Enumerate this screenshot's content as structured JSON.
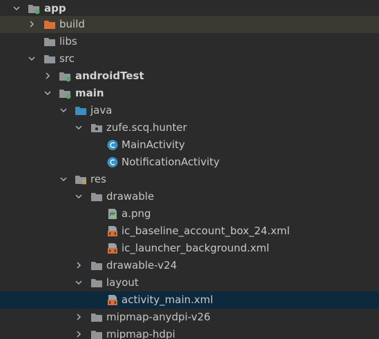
{
  "colors": {
    "background": "#2b2b2b",
    "build_row": "#3b3a32",
    "selected_row": "#0d293e",
    "folder_gray": "#909599",
    "folder_orange": "#d9703a",
    "folder_blue": "#3a8ec2",
    "module_dot": "#59a869",
    "class_icon": "#3592c4",
    "xml_icon": "#d9703a"
  },
  "tree": {
    "items": [
      {
        "label": "app"
      },
      {
        "label": "build"
      },
      {
        "label": "libs"
      },
      {
        "label": "src"
      },
      {
        "label": "androidTest"
      },
      {
        "label": "main"
      },
      {
        "label": "java"
      },
      {
        "label": "zufe.scq.hunter"
      },
      {
        "label": "MainActivity"
      },
      {
        "label": "NotificationActivity"
      },
      {
        "label": "res"
      },
      {
        "label": "drawable"
      },
      {
        "label": "a.png"
      },
      {
        "label": "ic_baseline_account_box_24.xml"
      },
      {
        "label": "ic_launcher_background.xml"
      },
      {
        "label": "drawable-v24"
      },
      {
        "label": "layout"
      },
      {
        "label": "activity_main.xml"
      },
      {
        "label": "mipmap-anydpi-v26"
      },
      {
        "label": "mipmap-hdpi"
      }
    ]
  }
}
